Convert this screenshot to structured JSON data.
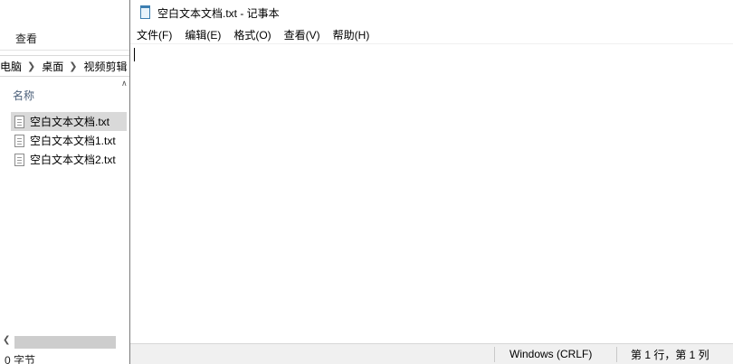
{
  "explorer": {
    "ribbon_tab": "查看",
    "breadcrumb": [
      "电脑",
      "桌面",
      "视频剪辑"
    ],
    "column_header": "名称",
    "files": [
      {
        "name": "空白文本文档.txt",
        "selected": true
      },
      {
        "name": "空白文本文档1.txt",
        "selected": false
      },
      {
        "name": "空白文本文档2.txt",
        "selected": false
      }
    ],
    "status": "0 字节"
  },
  "notepad": {
    "title": "空白文本文档.txt - 记事本",
    "menu": [
      "文件(F)",
      "编辑(E)",
      "格式(O)",
      "查看(V)",
      "帮助(H)"
    ],
    "content": "",
    "status": {
      "line_ending": "Windows (CRLF)",
      "position": "第 1 行，第 1 列"
    }
  },
  "icons": {
    "app": "notepad-icon",
    "file": "text-file-icon",
    "breadcrumb_separator": "chevron-right-icon",
    "scroll_up": "chevron-up-icon",
    "scroll_left": "chevron-left-icon"
  }
}
